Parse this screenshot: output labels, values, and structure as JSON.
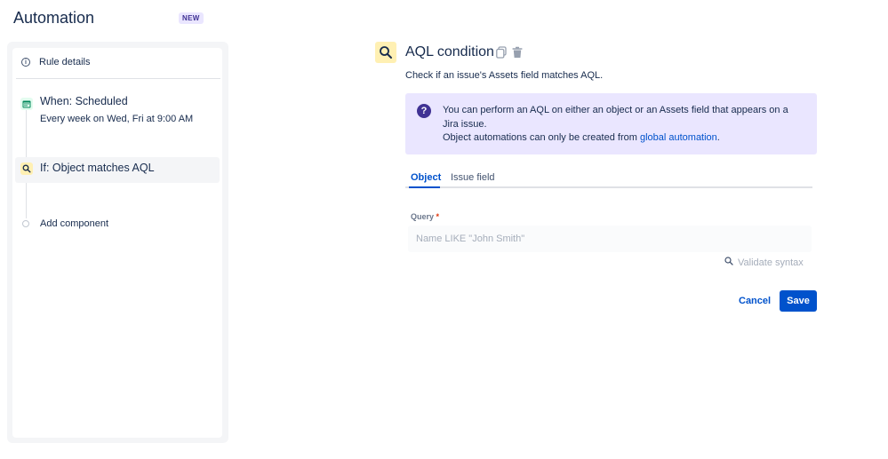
{
  "header": {
    "title": "Automation",
    "badge": "NEW"
  },
  "sidebar": {
    "rule_details_label": "Rule details",
    "steps": [
      {
        "title": "When: Scheduled",
        "subtitle": "Every week on Wed, Fri at 9:00 AM",
        "icon": "calendar-icon",
        "icon_color": "#00875a"
      },
      {
        "title": "If: Object matches AQL",
        "icon": "search-icon",
        "icon_color": "#172b4d",
        "selected": true
      }
    ],
    "add_component_label": "Add component"
  },
  "panel": {
    "title": "AQL condition",
    "description": "Check if an issue's Assets field matches AQL.",
    "banner": {
      "line1": "You can perform an AQL on either an object or an Assets field that appears on a Jira issue.",
      "line2_prefix": "Object automations can only be created from ",
      "link_text": "global automation",
      "line2_suffix": "."
    },
    "tabs": [
      {
        "label": "Object",
        "active": true
      },
      {
        "label": "Issue field",
        "active": false
      }
    ],
    "query": {
      "label": "Query",
      "required_mark": "*",
      "value": "",
      "placeholder": "Name LIKE \"John Smith\""
    },
    "validate_label": "Validate syntax",
    "cancel_label": "Cancel",
    "save_label": "Save"
  },
  "colors": {
    "accent": "#0052cc",
    "banner_bg": "#eae6ff",
    "banner_icon": "#403294",
    "condition_icon_bg": "#fff0b3"
  }
}
